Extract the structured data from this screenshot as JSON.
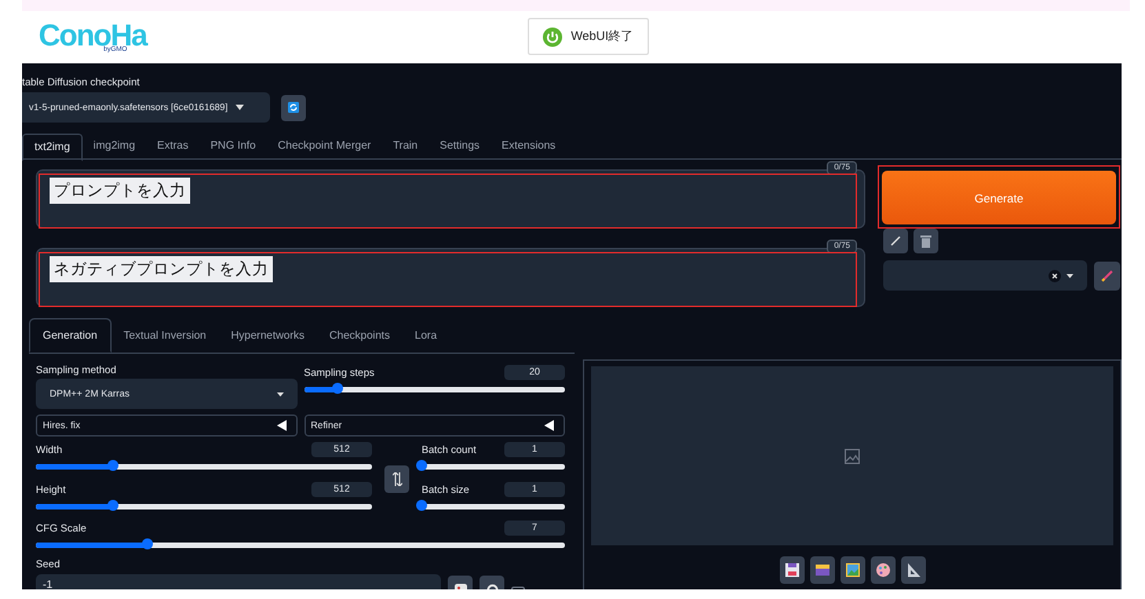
{
  "header": {
    "logo": "ConoHa",
    "logo_sub": "byGMO",
    "stop_button": "WebUI終了"
  },
  "checkpoint": {
    "label": "table Diffusion checkpoint",
    "value": "v1-5-pruned-emaonly.safetensors [6ce0161689]"
  },
  "tabs": [
    {
      "label": "txt2img",
      "selected": true
    },
    {
      "label": "img2img",
      "selected": false
    },
    {
      "label": "Extras",
      "selected": false
    },
    {
      "label": "PNG Info",
      "selected": false
    },
    {
      "label": "Checkpoint Merger",
      "selected": false
    },
    {
      "label": "Train",
      "selected": false
    },
    {
      "label": "Settings",
      "selected": false
    },
    {
      "label": "Extensions",
      "selected": false
    }
  ],
  "prompts": [
    {
      "counter": "0/75",
      "overlay": "プロンプトを入力"
    },
    {
      "counter": "0/75",
      "overlay": "ネガティブプロンプトを入力"
    }
  ],
  "generate": "Generate",
  "subtabs": [
    {
      "label": "Generation",
      "selected": true
    },
    {
      "label": "Textual Inversion",
      "selected": false
    },
    {
      "label": "Hypernetworks",
      "selected": false
    },
    {
      "label": "Checkpoints",
      "selected": false
    },
    {
      "label": "Lora",
      "selected": false
    }
  ],
  "sampling_method": {
    "label": "Sampling method",
    "value": "DPM++ 2M Karras"
  },
  "accordions": [
    {
      "label": "Hires. fix",
      "expanded": false
    },
    {
      "label": "Refiner",
      "expanded": false
    }
  ],
  "sliders": [
    {
      "label": "Sampling steps",
      "value": "20",
      "level": 0.13
    },
    {
      "label": "Width",
      "value": "512",
      "level": 0.23
    },
    {
      "label": "Batch count",
      "value": "1",
      "level": 0
    },
    {
      "label": "Height",
      "value": "512",
      "level": 0.23
    },
    {
      "label": "Batch size",
      "value": "1",
      "level": 0
    },
    {
      "label": "CFG Scale",
      "value": "7",
      "level": 0.21
    }
  ],
  "seed": {
    "label": "Seed",
    "value": "-1",
    "extra_checked": false
  }
}
